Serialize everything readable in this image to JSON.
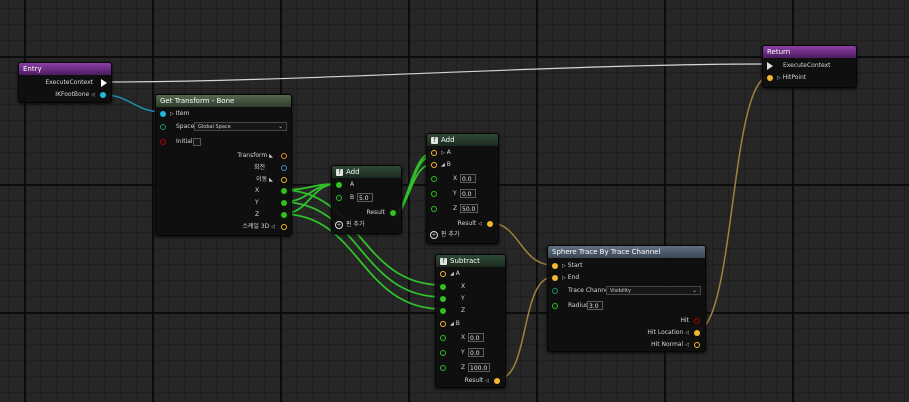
{
  "colors": {
    "exec": "#ffffff",
    "object": "#22b8e0",
    "struct_green": "#9bd23c",
    "float": "#30c020",
    "vector": "#f5b72e",
    "rotator": "#3f8fe0",
    "bool": "#b10000",
    "wire_vector": "#a08040",
    "wire_float": "#2fc02a"
  },
  "nodes": {
    "entry": {
      "title": "Entry",
      "pins": {
        "exec": "ExecuteContext",
        "ikfoot": "IKFootBone"
      }
    },
    "get_transform": {
      "title": "Get Transform - Bone",
      "pins": {
        "item": "Item",
        "space": "Space",
        "space_value": "Global Space",
        "initial": "Initial",
        "transform": "Transform",
        "rotation": "회전",
        "translation": "이동",
        "x": "X",
        "y": "Y",
        "z": "Z",
        "scale": "스케일 3D"
      }
    },
    "add1": {
      "title": "Add",
      "pins": {
        "a": "A",
        "b": "B",
        "b_value": "5.0",
        "result": "Result",
        "add_pin": "핀 추가"
      }
    },
    "add2": {
      "title": "Add",
      "pins": {
        "a": "A",
        "b": "B",
        "x": "X",
        "y": "Y",
        "z": "Z",
        "x_value": "0.0",
        "y_value": "0.0",
        "z_value": "50.0",
        "result": "Result",
        "add_pin": "핀 추가"
      }
    },
    "subtract": {
      "title": "Subtract",
      "pins": {
        "a": "A",
        "x": "X",
        "y": "Y",
        "z": "Z",
        "b": "B",
        "bx": "X",
        "by": "Y",
        "bz": "Z",
        "bx_value": "0.0",
        "by_value": "0.0",
        "bz_value": "100.0",
        "result": "Result"
      }
    },
    "sphere_trace": {
      "title": "Sphere Trace By Trace Channel",
      "pins": {
        "start": "Start",
        "end": "End",
        "channel": "Trace Channel",
        "channel_value": "Visibility",
        "radius": "Radius",
        "radius_value": "3.0",
        "hit": "Hit",
        "hit_location": "Hit Location",
        "hit_normal": "Hit Normal"
      }
    },
    "return": {
      "title": "Return",
      "pins": {
        "exec": "ExecuteContext",
        "hitpoint": "HitPoint"
      }
    }
  }
}
